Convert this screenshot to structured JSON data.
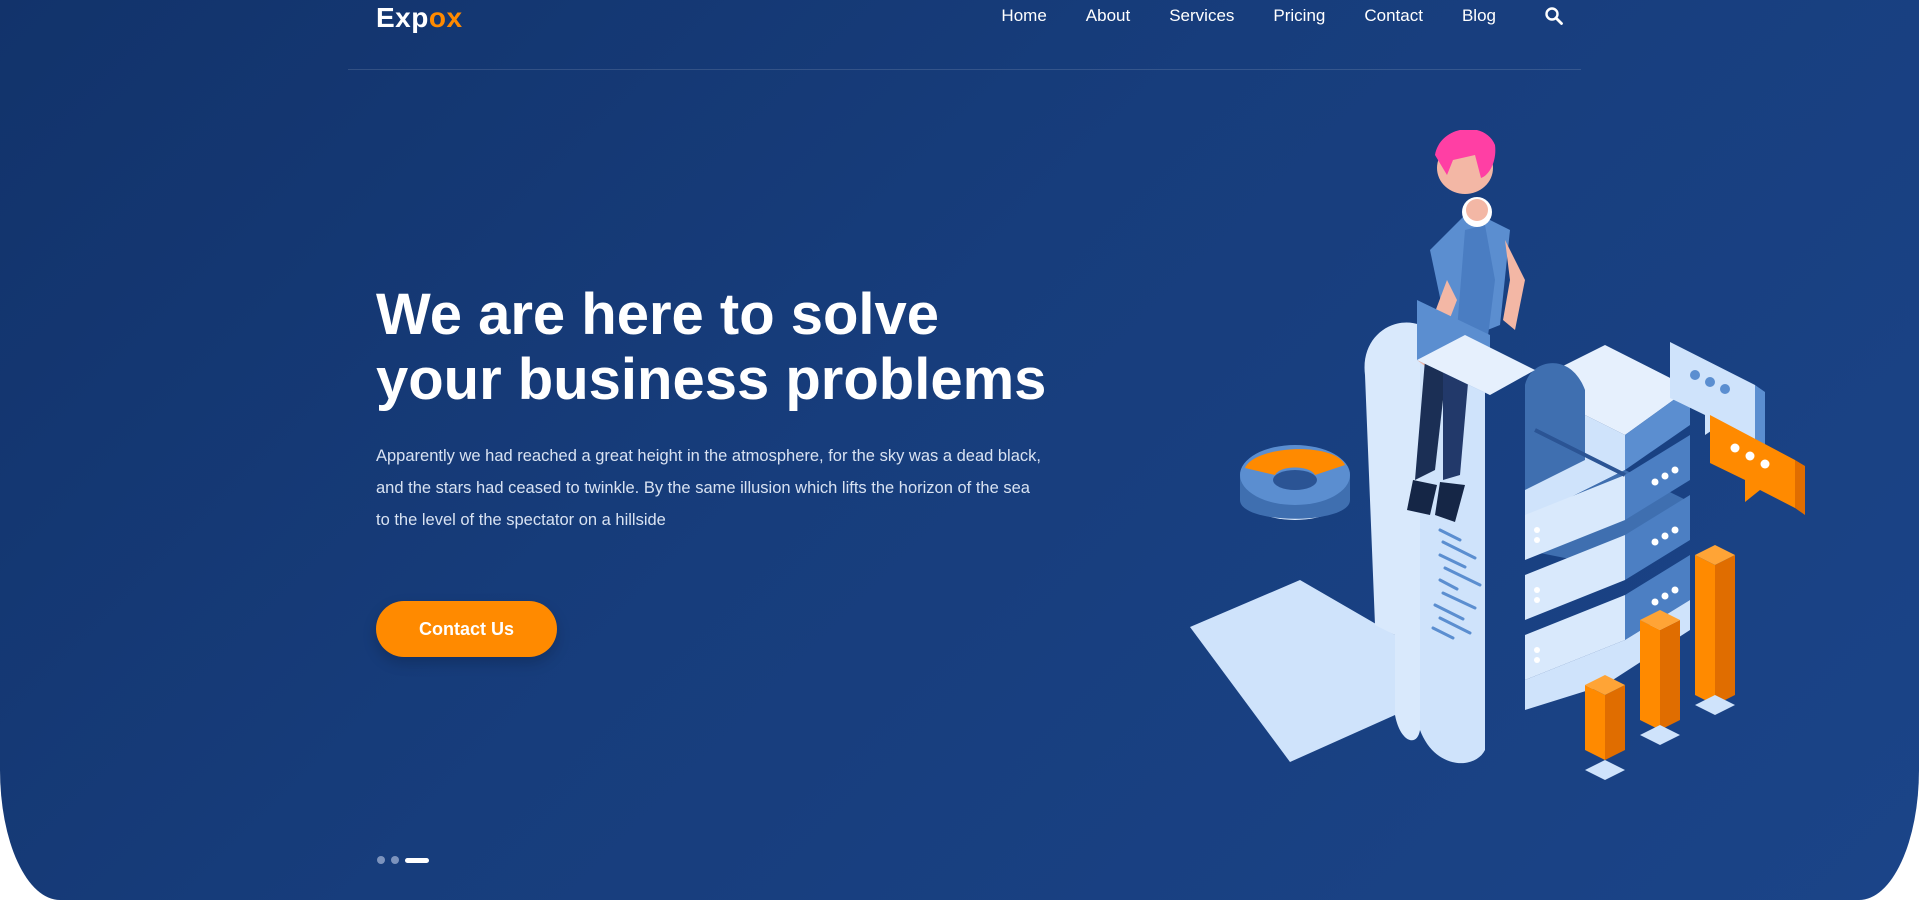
{
  "brand": {
    "logo_main": "Exp",
    "logo_accent": "ox"
  },
  "nav": {
    "items": [
      "Home",
      "About",
      "Services",
      "Pricing",
      "Contact",
      "Blog"
    ],
    "search_icon": "search-icon"
  },
  "hero": {
    "headline_line1": "We are here to solve",
    "headline_line2": "your business problems",
    "subtext_line1": "Apparently we had reached a great height in the atmosphere, for the sky was a dead black,",
    "subtext_line2": "and the stars had ceased to twinkle. By the same illusion which lifts the horizon of the sea",
    "subtext_line3": "to the level of the spectator on a hillside",
    "cta_label": "Contact Us",
    "slider": {
      "count": 3,
      "active_index": 3
    }
  },
  "colors": {
    "background": "#173d7c",
    "accent": "#ff8a00",
    "text": "#ffffff",
    "illustration_light": "#cfe3fb",
    "illustration_mid": "#5b8ed0",
    "illustration_pink": "#ff3fa4"
  }
}
